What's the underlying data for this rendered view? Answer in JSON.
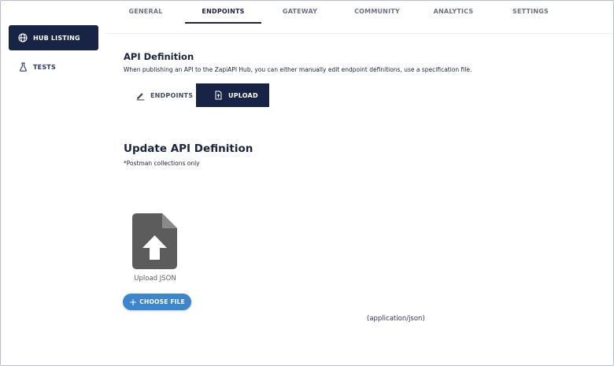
{
  "tabs": [
    {
      "label": "GENERAL",
      "active": false
    },
    {
      "label": "ENDPOINTS",
      "active": true
    },
    {
      "label": "GATEWAY",
      "active": false
    },
    {
      "label": "COMMUNITY",
      "active": false
    },
    {
      "label": "ANALYTICS",
      "active": false
    },
    {
      "label": "SETTINGS",
      "active": false
    }
  ],
  "sidebar": {
    "items": [
      {
        "label": "HUB LISTING",
        "icon": "globe-icon",
        "active": true
      },
      {
        "label": "TESTS",
        "icon": "flask-icon",
        "active": false
      }
    ]
  },
  "api_definition": {
    "title": "API Definition",
    "description": "When publishing an API to the ZapiAPI Hub, you can either manually edit endpoint definitions, use a specification file.",
    "toggle": {
      "endpoints_label": "ENDPOINTS",
      "upload_label": "UPLOAD",
      "selected": "UPLOAD"
    }
  },
  "update": {
    "title": "Update API Definition",
    "note": "*Postman collections only",
    "upload_label": "Upload JSON",
    "choose_button": "CHOOSE FILE",
    "mime_type": "(application/json)"
  },
  "colors": {
    "navy": "#172445",
    "accent_blue": "#3b86cc",
    "icon_gray": "#5c5c5c"
  }
}
